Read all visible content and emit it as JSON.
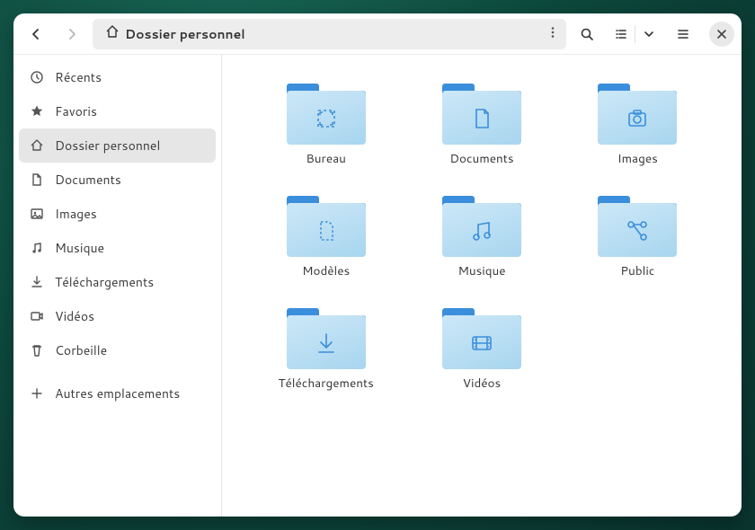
{
  "pathbar": {
    "crumb": "Dossier personnel"
  },
  "sidebar": {
    "items": [
      {
        "label": "Récents"
      },
      {
        "label": "Favoris"
      },
      {
        "label": "Dossier personnel"
      },
      {
        "label": "Documents"
      },
      {
        "label": "Images"
      },
      {
        "label": "Musique"
      },
      {
        "label": "Téléchargements"
      },
      {
        "label": "Vidéos"
      },
      {
        "label": "Corbeille"
      }
    ],
    "other": {
      "label": "Autres emplacements"
    }
  },
  "folders": [
    {
      "label": "Bureau"
    },
    {
      "label": "Documents"
    },
    {
      "label": "Images"
    },
    {
      "label": "Modèles"
    },
    {
      "label": "Musique"
    },
    {
      "label": "Public"
    },
    {
      "label": "Téléchargements"
    },
    {
      "label": "Vidéos"
    }
  ]
}
